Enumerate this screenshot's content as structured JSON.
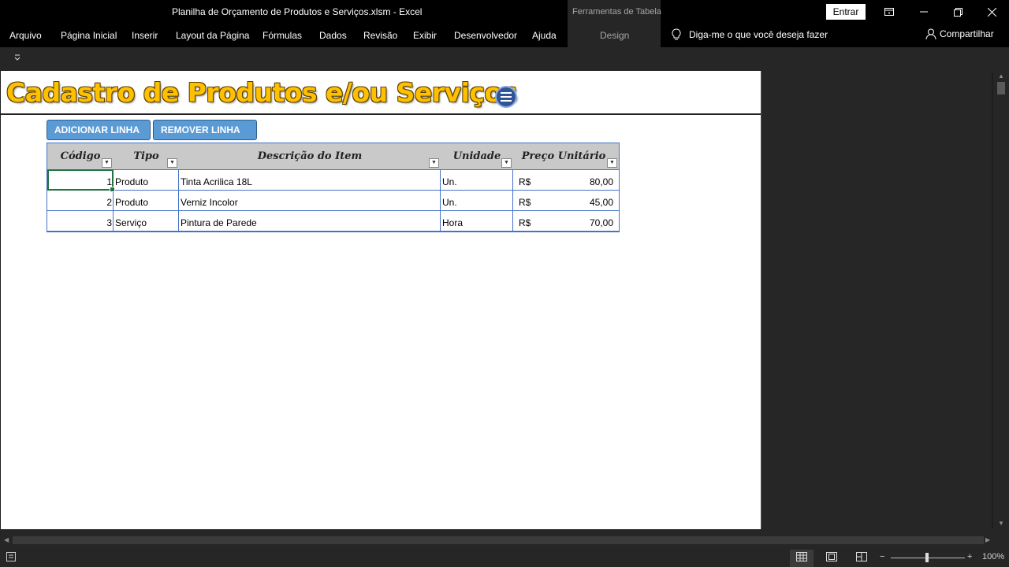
{
  "window": {
    "title": "Planilha de Orçamento de Produtos e Serviços.xlsm  -  Excel",
    "table_tools": "Ferramentas de Tabela",
    "signin": "Entrar"
  },
  "ribbon": {
    "tabs": [
      "Arquivo",
      "Página Inicial",
      "Inserir",
      "Layout da Página",
      "Fórmulas",
      "Dados",
      "Revisão",
      "Exibir",
      "Desenvolvedor",
      "Ajuda"
    ],
    "design_tab": "Design",
    "tell_me": "Diga-me o que você deseja fazer",
    "share": "Compartilhar"
  },
  "sheet": {
    "title": "Cadastro de Produtos e/ou Serviços",
    "buttons": {
      "add": "ADICIONAR LINHA",
      "remove": "REMOVER LINHA"
    },
    "table": {
      "headers": [
        "Código",
        "Tipo",
        "Descrição do Item",
        "Unidade",
        "Preço Unitário"
      ],
      "rows": [
        {
          "codigo": "1",
          "tipo": "Produto",
          "descricao": "Tinta Acrilica 18L",
          "unidade": "Un.",
          "moeda": "R$",
          "preco": "80,00"
        },
        {
          "codigo": "2",
          "tipo": "Produto",
          "descricao": "Verniz Incolor",
          "unidade": "Un.",
          "moeda": "R$",
          "preco": "45,00"
        },
        {
          "codigo": "3",
          "tipo": "Serviço",
          "descricao": "Pintura de Parede",
          "unidade": "Hora",
          "moeda": "R$",
          "preco": "70,00"
        }
      ]
    }
  },
  "status": {
    "zoom": "100%"
  },
  "colors": {
    "title_gold": "#ffc000",
    "table_border": "#4472c4",
    "header_fill": "#c9c9c9",
    "button_blue": "#5b9bd5"
  }
}
